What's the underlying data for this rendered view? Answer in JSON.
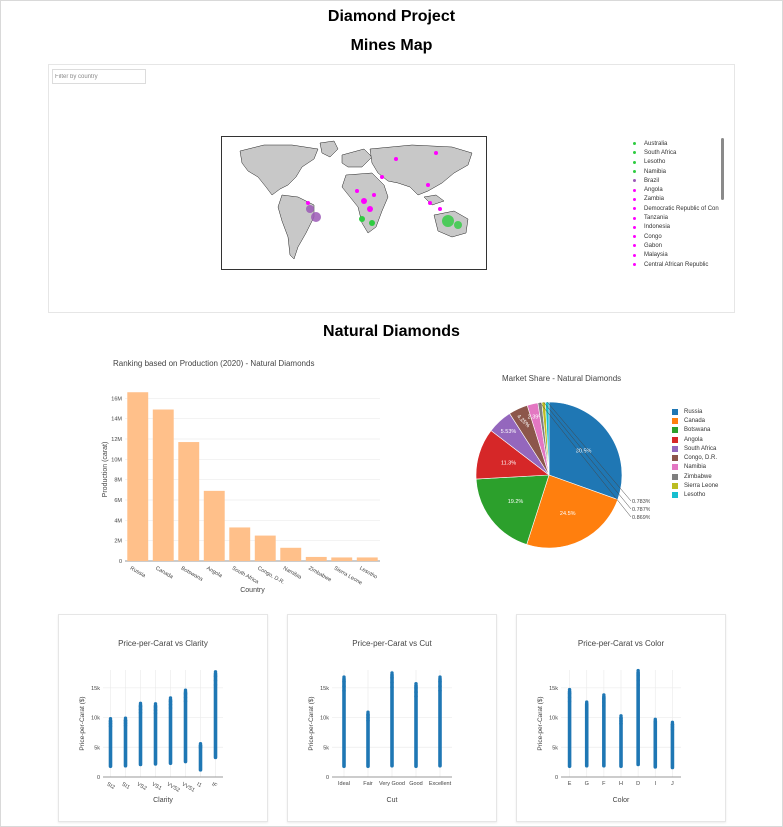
{
  "page": {
    "title": "Diamond Project"
  },
  "mines_map": {
    "title": "Mines Map",
    "filter_placeholder": "Filter by country",
    "legend": [
      {
        "name": "Australia",
        "color": "#2ecc40"
      },
      {
        "name": "South Africa",
        "color": "#2ecc40"
      },
      {
        "name": "Lesotho",
        "color": "#2ecc40"
      },
      {
        "name": "Namibia",
        "color": "#2ecc40"
      },
      {
        "name": "Brazil",
        "color": "#9b59b6"
      },
      {
        "name": "Angola",
        "color": "#ff00ff"
      },
      {
        "name": "Zambia",
        "color": "#ff00ff"
      },
      {
        "name": "Democratic Republic of Con",
        "color": "#ff00ff"
      },
      {
        "name": "Tanzania",
        "color": "#ff00ff"
      },
      {
        "name": "Indonesia",
        "color": "#ff00ff"
      },
      {
        "name": "Congo",
        "color": "#ff00ff"
      },
      {
        "name": "Gabon",
        "color": "#ff00ff"
      },
      {
        "name": "Malaysia",
        "color": "#ff00ff"
      },
      {
        "name": "Central African Republic",
        "color": "#ff00ff"
      }
    ]
  },
  "natural": {
    "title": "Natural Diamonds"
  },
  "chart_data": [
    {
      "type": "bar",
      "title": "Ranking based on Production (2020) - Natural Diamonds",
      "xlabel": "Country",
      "ylabel": "Production (carat)",
      "categories": [
        "Russia",
        "Canada",
        "Botswana",
        "Angola",
        "South Africa",
        "Congo, D.R.",
        "Namibia",
        "Zimbabwe",
        "Sierra Leone",
        "Lesotho"
      ],
      "values": [
        16600000,
        14900000,
        11700000,
        6900000,
        3300000,
        2500000,
        1300000,
        400000,
        350000,
        350000
      ],
      "ylim": [
        0,
        18000000
      ],
      "yticks": [
        "0",
        "2M",
        "4M",
        "6M",
        "8M",
        "10M",
        "12M",
        "14M",
        "16M"
      ],
      "color": "#ffc08a"
    },
    {
      "type": "pie",
      "title": "Market Share - Natural Diamonds",
      "labels": [
        "Russia",
        "Canada",
        "Botswana",
        "Angola",
        "South Africa",
        "Congo, D.R.",
        "Namibia",
        "Zimbabwe",
        "Sierra Leone",
        "Lesotho"
      ],
      "values": [
        30.5,
        24.5,
        19.2,
        11.3,
        5.53,
        4.25,
        2.39,
        0.869,
        0.787,
        0.783
      ],
      "value_labels": [
        "30.5%",
        "24.5%",
        "19.2%",
        "11.3%",
        "5.53%",
        "4.25%",
        "2.39%",
        "0.869%",
        "0.787%",
        "0.783%"
      ],
      "colors": [
        "#1f77b4",
        "#ff7f0e",
        "#2ca02c",
        "#d62728",
        "#9467bd",
        "#8c564b",
        "#e377c2",
        "#7f7f7f",
        "#bcbd22",
        "#17becf"
      ],
      "legend": "right"
    },
    {
      "type": "scatter",
      "title": "Price-per-Carat vs Clarity",
      "xlabel": "Clarity",
      "ylabel": "Price-per-Carat ($)",
      "categories": [
        "SI2",
        "SI1",
        "VS2",
        "VS1",
        "VVS2",
        "VVS1",
        "I1",
        "IF"
      ],
      "ranges": [
        [
          1500,
          9800
        ],
        [
          1600,
          9900
        ],
        [
          1800,
          12400
        ],
        [
          1900,
          12300
        ],
        [
          2000,
          13300
        ],
        [
          2300,
          14600
        ],
        [
          900,
          5600
        ],
        [
          3000,
          17700
        ]
      ],
      "yticks": [
        "0",
        "5k",
        "10k",
        "15k"
      ],
      "ylim": [
        0,
        18000
      ],
      "color": "#1f77b4"
    },
    {
      "type": "scatter",
      "title": "Price-per-Carat vs Cut",
      "xlabel": "Cut",
      "ylabel": "Price-per-Carat ($)",
      "categories": [
        "Ideal",
        "Fair",
        "Very Good",
        "Good",
        "Excellent"
      ],
      "ranges": [
        [
          1500,
          16800
        ],
        [
          1500,
          10900
        ],
        [
          1600,
          17500
        ],
        [
          1500,
          15700
        ],
        [
          1600,
          16800
        ]
      ],
      "yticks": [
        "0",
        "5k",
        "10k",
        "15k"
      ],
      "ylim": [
        0,
        18000
      ],
      "color": "#1f77b4"
    },
    {
      "type": "scatter",
      "title": "Price-per-Carat vs Color",
      "xlabel": "Color",
      "ylabel": "Price-per-Carat ($)",
      "categories": [
        "E",
        "G",
        "F",
        "H",
        "D",
        "I",
        "J"
      ],
      "ranges": [
        [
          1500,
          14700
        ],
        [
          1600,
          12600
        ],
        [
          1600,
          13800
        ],
        [
          1500,
          10300
        ],
        [
          1800,
          17900
        ],
        [
          1400,
          9700
        ],
        [
          1300,
          9200
        ]
      ],
      "yticks": [
        "0",
        "5k",
        "10k",
        "15k"
      ],
      "ylim": [
        0,
        18000
      ],
      "color": "#1f77b4"
    }
  ]
}
